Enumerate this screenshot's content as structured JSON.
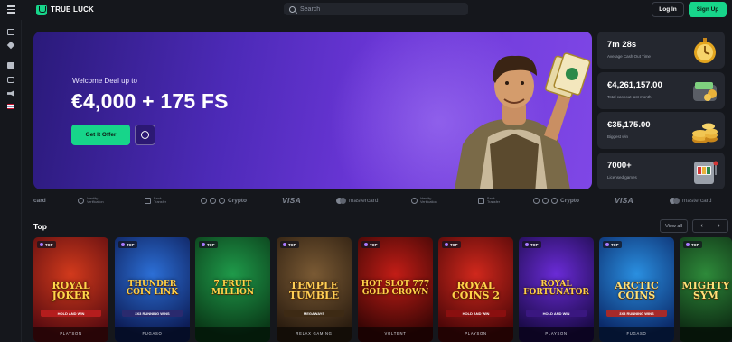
{
  "header": {
    "brand": "TRUE LUCK",
    "search_placeholder": "Search",
    "login_label": "Log In",
    "signup_label": "Sign Up"
  },
  "rail_icons": [
    "casino-icon",
    "diamond-icon",
    "gift-icon",
    "dice-icon",
    "megaphone-icon",
    "uk-flag-icon"
  ],
  "hero": {
    "subtitle": "Welcome Deal up to",
    "title": "€4,000 + 175 FS",
    "cta_label": "Get It Offer"
  },
  "stats": [
    {
      "value": "7m 28s",
      "label": "Average Cash Out Time",
      "icon": "stopwatch-icon"
    },
    {
      "value": "€4,261,157.00",
      "label": "Total cashout last month",
      "icon": "wallet-icon"
    },
    {
      "value": "€35,175.00",
      "label": "Biggest win",
      "icon": "coins-icon"
    },
    {
      "value": "7000+",
      "label": "Licensed games",
      "icon": "slot-machine-icon"
    }
  ],
  "payments": {
    "card_fragment": "card",
    "identity_line1": "Identity",
    "identity_line2": "Verification",
    "bank_line1": "Bank",
    "bank_line2": "Transfer",
    "crypto": "Crypto",
    "visa": "VISA",
    "mastercard": "mastercard"
  },
  "top": {
    "title": "Top",
    "view_all_label": "View all",
    "prev_label": "‹",
    "next_label": "›",
    "badge_label": "TOP",
    "games": [
      {
        "name": "ROYAL JOKER",
        "subtitle": "HOLD AND WIN",
        "provider": "PLAYSON",
        "bg1": "#d23a1c",
        "bg2": "#5a0c10",
        "text": "#ffd64a",
        "sub_bg": "#b41d1d"
      },
      {
        "name": "THUNDER COIN LINK",
        "subtitle": "3X3 RUNNING WINS",
        "provider": "FUGASO",
        "bg1": "#2c6fd6",
        "bg2": "#0d1d57",
        "text": "#ffd24a",
        "sub_bg": "#2a2a6e"
      },
      {
        "name": "7 FRUIT MILLION",
        "subtitle": "",
        "provider": "",
        "bg1": "#1f9a4a",
        "bg2": "#0a3a18",
        "text": "#ffd64a",
        "sub_bg": "#0a3a18"
      },
      {
        "name": "TEMPLE TUMBLE",
        "subtitle": "MEGAWAYS",
        "provider": "RELAX GAMING",
        "bg1": "#7a5a34",
        "bg2": "#2b1d10",
        "text": "#ffcf55",
        "sub_bg": "#3d2a14"
      },
      {
        "name": "HOT SLOT 777 GOLD CROWN",
        "subtitle": "",
        "provider": "VOLTENT",
        "bg1": "#c21d16",
        "bg2": "#3a0605",
        "text": "#ffd24a",
        "sub_bg": "#3a0605"
      },
      {
        "name": "ROYAL COINS 2",
        "subtitle": "HOLD AND WIN",
        "provider": "PLAYSON",
        "bg1": "#d0281c",
        "bg2": "#4d0708",
        "text": "#ffd24a",
        "sub_bg": "#8a0f0f"
      },
      {
        "name": "ROYAL FORTUNATOR",
        "subtitle": "HOLD AND WIN",
        "provider": "PLAYSON",
        "bg1": "#6a2bd6",
        "bg2": "#1c0b4a",
        "text": "#ffd24a",
        "sub_bg": "#3a1780"
      },
      {
        "name": "ARCTIC COINS",
        "subtitle": "3X3 RUNNING WINS",
        "provider": "FUGASO",
        "bg1": "#2a8fe0",
        "bg2": "#0b2a6a",
        "text": "#ffe27a",
        "sub_bg": "#a52a2a"
      },
      {
        "name": "MIGHTY SYM",
        "subtitle": "",
        "provider": "",
        "bg1": "#2e8a3a",
        "bg2": "#0e2e14",
        "text": "#ffe27a",
        "sub_bg": "#0e2e14"
      }
    ]
  }
}
